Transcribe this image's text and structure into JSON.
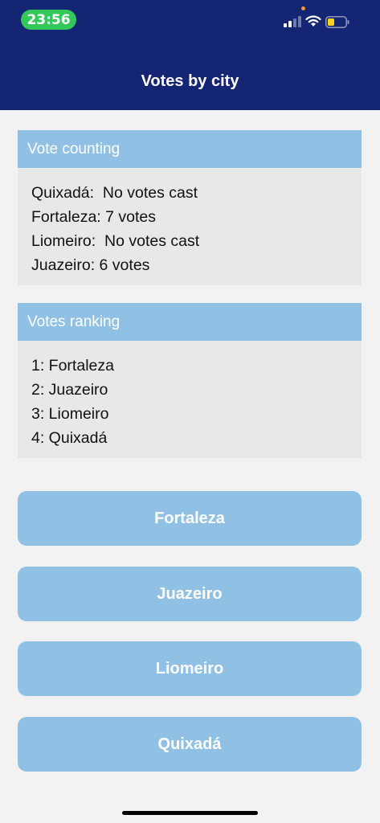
{
  "status_bar": {
    "time": "23:56",
    "icons": [
      "signal-icon",
      "wifi-icon",
      "battery-icon"
    ],
    "colors": {
      "time_pill": "#34c759",
      "battery_level": "#f4d21f",
      "privacy_dot": "#f29a2e"
    },
    "battery_level": 0.3
  },
  "nav": {
    "title": "Votes by city",
    "background": "#142673"
  },
  "vote_counting": {
    "title": "Vote counting",
    "lines": [
      "Quixadá:  No votes cast",
      "Fortaleza: 7 votes",
      "Liomeiro:  No votes cast",
      "Juazeiro: 6 votes"
    ]
  },
  "votes_ranking": {
    "title": "Votes ranking",
    "lines": [
      "1: Fortaleza",
      "2: Juazeiro",
      "3: Liomeiro",
      "4: Quixadá"
    ]
  },
  "buttons": [
    "Fortaleza",
    "Juazeiro",
    "Liomeiro",
    "Quixadá"
  ],
  "accent": "#90c1e4"
}
